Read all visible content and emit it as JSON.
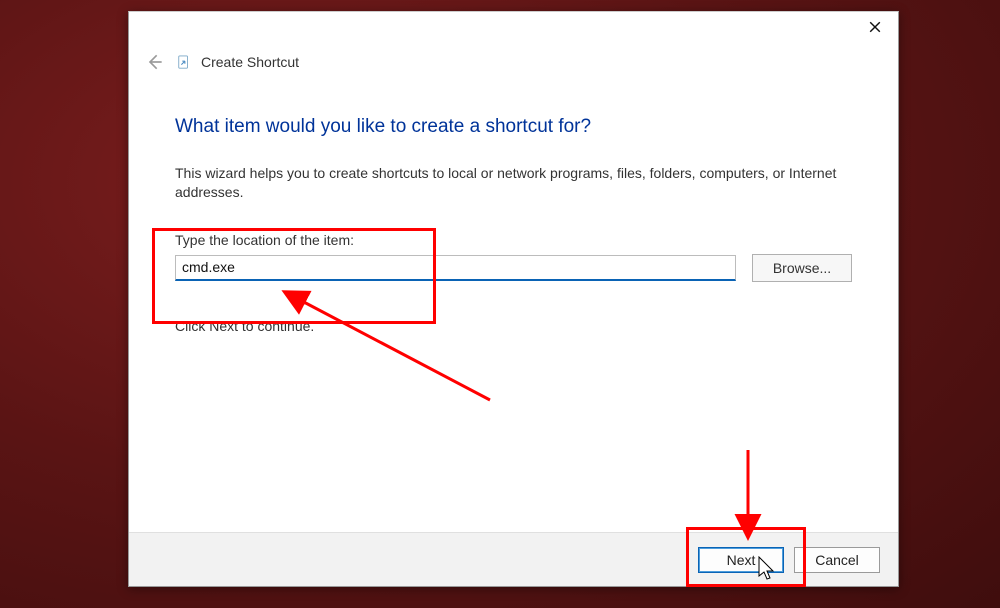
{
  "window": {
    "title": "Create Shortcut"
  },
  "content": {
    "heading": "What item would you like to create a shortcut for?",
    "help_text": "This wizard helps you to create shortcuts to local or network programs, files, folders, computers, or Internet addresses.",
    "field_label": "Type the location of the item:",
    "location_value": "cmd.exe",
    "browse_label": "Browse...",
    "continue_text": "Click Next to continue."
  },
  "footer": {
    "next_label": "Next",
    "cancel_label": "Cancel"
  },
  "annotations": {
    "highlight_color": "#ff0000"
  }
}
